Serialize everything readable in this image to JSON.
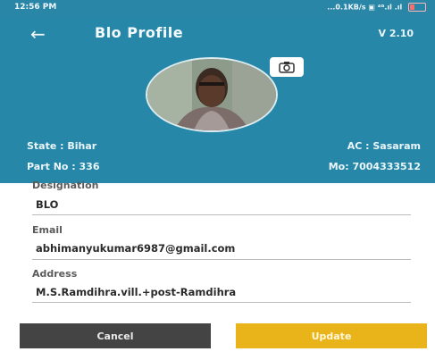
{
  "status": {
    "time": "12:56 PM",
    "network": "...0.1KB/s",
    "icons": "▣ ⁴ᴳ.ıl .ıl"
  },
  "header": {
    "title": "Blo Profile",
    "version": "V 2.10",
    "back_icon": "arrow-left-icon",
    "camera_icon": "camera-icon"
  },
  "profile": {
    "state": "State : Bihar",
    "ac": "AC : Sasaram",
    "part": "Part No : 336",
    "mobile": "Mo: 7004333512"
  },
  "form": {
    "designation_label": "Designation",
    "designation_value": "BLO",
    "email_label": "Email",
    "email_value": "abhimanyukumar6987@gmail.com",
    "address_label": "Address",
    "address_value": "M.S.Ramdihra.vill.+post-Ramdihra"
  },
  "buttons": {
    "cancel": "Cancel",
    "update": "Update"
  },
  "colors": {
    "header": "#2787a8",
    "cancel": "#444444",
    "update": "#e8b41a"
  }
}
